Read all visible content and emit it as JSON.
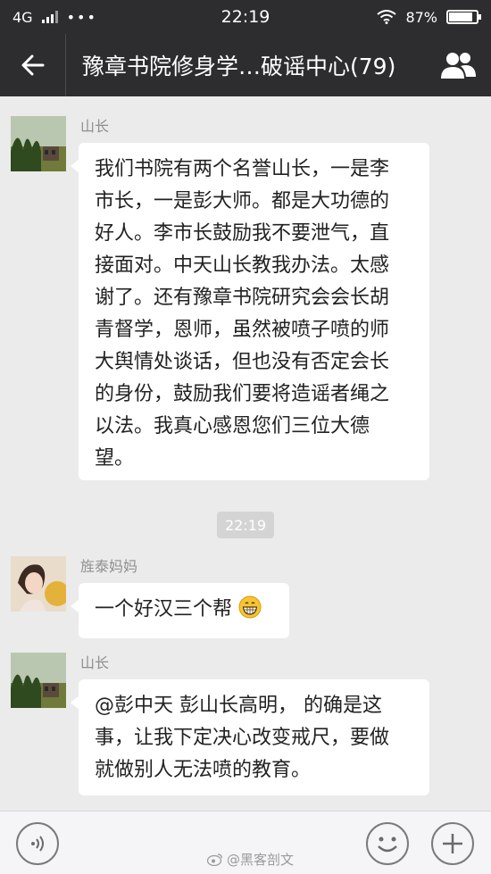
{
  "status_bar": {
    "network": "4G",
    "time": "22:19",
    "battery_text": "87%",
    "battery_level": 0.87
  },
  "header": {
    "title": "豫章书院修身学…破谣中心(79)",
    "back_icon": "back-arrow-icon",
    "members_icon": "group-members-icon",
    "bg_color": "#2d2d2f"
  },
  "messages": [
    {
      "sender": "山长",
      "lines": [
        "我们书院有两个名誉山长，一是李",
        "市长，一是彭大师。都是大功德的",
        "好人。李市长鼓励我不要泄气，直",
        "接面对。中天山长教我办法。太感",
        "谢了。还有豫章书院研究会会长胡",
        "青督学，恩师，虽然被喷子喷的师",
        "大舆情处谈话，但也没有否定会长",
        "的身份，鼓励我们要将造谣者绳之",
        "以法。我真心感恩您们三位大德",
        "望。"
      ]
    },
    {
      "sender": "旌泰妈妈",
      "lines": [
        "一个好汉三个帮"
      ],
      "emoji": "grinning-face-icon"
    },
    {
      "sender": "山长",
      "lines": [
        "@彭中天 彭山长高明， 的确是这",
        "事，让我下定决心改变戒尺，要做",
        "就做别人无法喷的教育。"
      ]
    }
  ],
  "timestamp": "22:19",
  "input_bar": {
    "voice_icon": "voice-icon",
    "emoji_icon": "emoji-icon",
    "plus_icon": "plus-icon"
  },
  "watermark": "@黑客剖文",
  "colors": {
    "chat_bg": "#ebebeb",
    "bubble_bg": "#ffffff",
    "sender_text": "#8f8f8f"
  }
}
